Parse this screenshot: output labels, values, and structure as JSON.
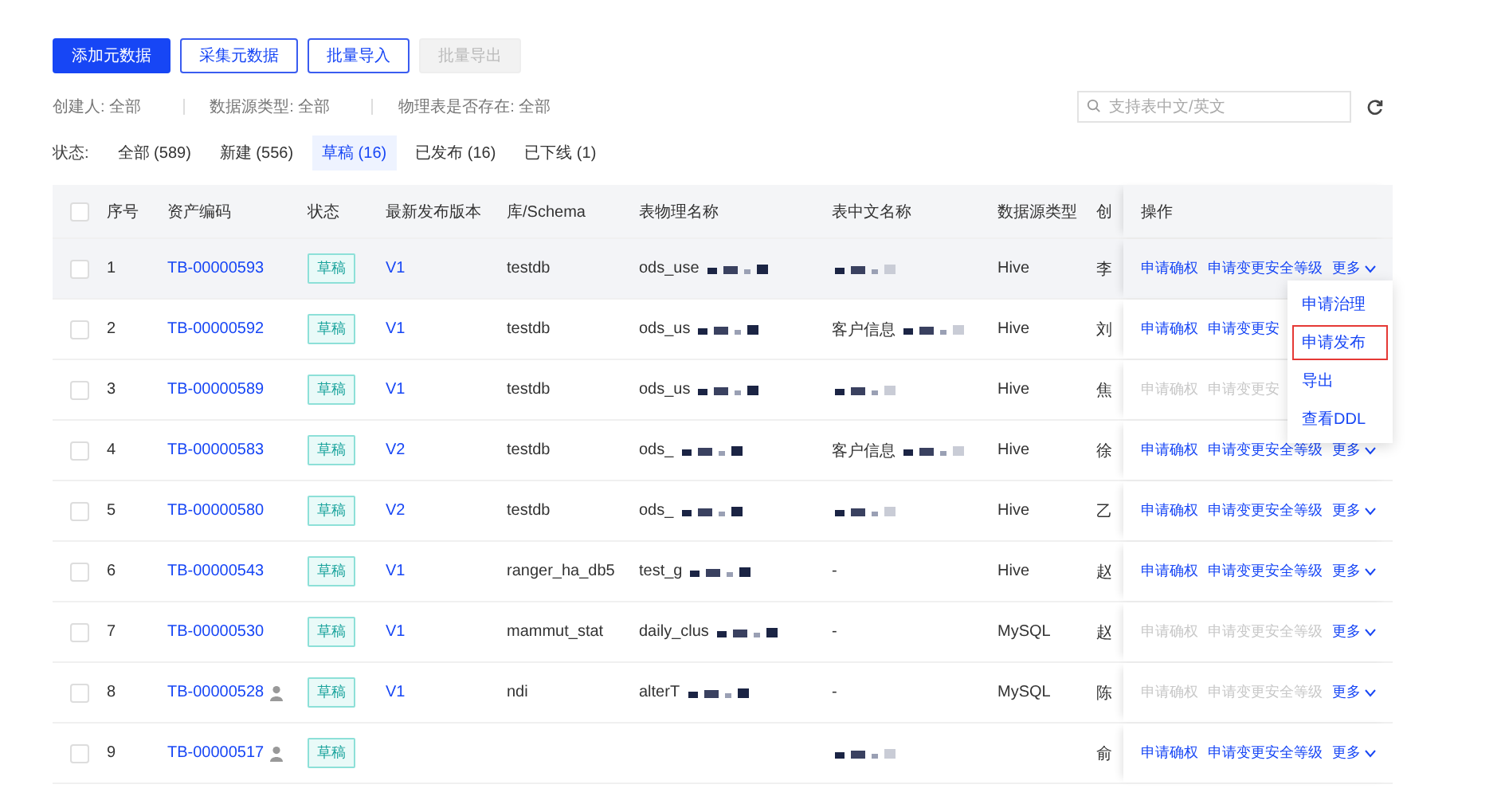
{
  "toolbar": {
    "buttons": [
      {
        "label": "添加元数据",
        "kind": "primary",
        "disabled": false
      },
      {
        "label": "采集元数据",
        "kind": "outline",
        "disabled": false
      },
      {
        "label": "批量导入",
        "kind": "outline",
        "disabled": false
      },
      {
        "label": "批量导出",
        "kind": "outline",
        "disabled": true
      }
    ]
  },
  "filters": [
    {
      "label": "创建人:",
      "value": "全部"
    },
    {
      "label": "数据源类型:",
      "value": "全部"
    },
    {
      "label": "物理表是否存在:",
      "value": "全部"
    }
  ],
  "search": {
    "placeholder": "支持表中文/英文"
  },
  "status_tabs": {
    "label": "状态:",
    "tabs": [
      {
        "label": "全部 (589)",
        "selected": false
      },
      {
        "label": "新建 (556)",
        "selected": false
      },
      {
        "label": "草稿 (16)",
        "selected": true
      },
      {
        "label": "已发布 (16)",
        "selected": false
      },
      {
        "label": "已下线 (1)",
        "selected": false
      }
    ]
  },
  "table": {
    "select_all": {
      "checked": false
    },
    "columns": [
      "序号",
      "资产编码",
      "状态",
      "最新发布版本",
      "库/Schema",
      "表物理名称",
      "表中文名称",
      "数据源类型",
      "创",
      "操作"
    ],
    "rows": [
      {
        "index": "1",
        "code": "TB-00000593",
        "owner_icon": false,
        "status": "草稿",
        "version": "V1",
        "schema": "testdb",
        "physical": "ods_use",
        "physical_redacted": true,
        "chinese": "",
        "chinese_redacted": true,
        "source": "Hive",
        "creator": "李",
        "hovered": true,
        "actions": [
          {
            "label": "申请确权",
            "disabled": false
          },
          {
            "label": "申请变更安全等级",
            "disabled": false
          }
        ],
        "more": "更多"
      },
      {
        "index": "2",
        "code": "TB-00000592",
        "owner_icon": false,
        "status": "草稿",
        "version": "V1",
        "schema": "testdb",
        "physical": "ods_us",
        "physical_redacted": true,
        "chinese": "客户信息",
        "chinese_redacted": true,
        "source": "Hive",
        "creator": "刘",
        "hovered": false,
        "actions": [
          {
            "label": "申请确权",
            "disabled": false
          },
          {
            "label": "申请变更安",
            "disabled": false
          }
        ]
      },
      {
        "index": "3",
        "code": "TB-00000589",
        "owner_icon": false,
        "status": "草稿",
        "version": "V1",
        "schema": "testdb",
        "physical": "ods_us",
        "physical_redacted": true,
        "chinese": "",
        "chinese_redacted": true,
        "source": "Hive",
        "creator": "焦",
        "hovered": false,
        "actions": [
          {
            "label": "申请确权",
            "disabled": true
          },
          {
            "label": "申请变更安",
            "disabled": true
          }
        ]
      },
      {
        "index": "4",
        "code": "TB-00000583",
        "owner_icon": false,
        "status": "草稿",
        "version": "V2",
        "schema": "testdb",
        "physical": "ods_",
        "physical_redacted": true,
        "chinese": "客户信息",
        "chinese_redacted": true,
        "source": "Hive",
        "creator": "徐",
        "hovered": false,
        "actions": [
          {
            "label": "申请确权",
            "disabled": false
          },
          {
            "label": "申请变更安全等级",
            "disabled": false
          }
        ],
        "more": "更多"
      },
      {
        "index": "5",
        "code": "TB-00000580",
        "owner_icon": false,
        "status": "草稿",
        "version": "V2",
        "schema": "testdb",
        "physical": "ods_",
        "physical_redacted": true,
        "chinese": "",
        "chinese_redacted": true,
        "source": "Hive",
        "creator": "乙",
        "hovered": false,
        "actions": [
          {
            "label": "申请确权",
            "disabled": false
          },
          {
            "label": "申请变更安全等级",
            "disabled": false
          }
        ],
        "more": "更多"
      },
      {
        "index": "6",
        "code": "TB-00000543",
        "owner_icon": false,
        "status": "草稿",
        "version": "V1",
        "schema": "ranger_ha_db5",
        "physical": "test_g",
        "physical_redacted": true,
        "chinese": "-",
        "chinese_redacted": false,
        "source": "Hive",
        "creator": "赵",
        "hovered": false,
        "actions": [
          {
            "label": "申请确权",
            "disabled": false
          },
          {
            "label": "申请变更安全等级",
            "disabled": false
          }
        ],
        "more": "更多"
      },
      {
        "index": "7",
        "code": "TB-00000530",
        "owner_icon": false,
        "status": "草稿",
        "version": "V1",
        "schema": "mammut_stat",
        "physical": "daily_clus",
        "physical_redacted": true,
        "chinese": "-",
        "chinese_redacted": false,
        "source": "MySQL",
        "creator": "赵",
        "hovered": false,
        "actions": [
          {
            "label": "申请确权",
            "disabled": true
          },
          {
            "label": "申请变更安全等级",
            "disabled": true
          }
        ],
        "more": "更多"
      },
      {
        "index": "8",
        "code": "TB-00000528",
        "owner_icon": true,
        "status": "草稿",
        "version": "V1",
        "schema": "ndi",
        "physical": "alterT",
        "physical_redacted": true,
        "chinese": "-",
        "chinese_redacted": false,
        "source": "MySQL",
        "creator": "陈",
        "hovered": false,
        "actions": [
          {
            "label": "申请确权",
            "disabled": true
          },
          {
            "label": "申请变更安全等级",
            "disabled": true
          }
        ],
        "more": "更多"
      },
      {
        "index": "9",
        "code": "TB-00000517",
        "owner_icon": true,
        "status": "草稿",
        "version": "",
        "schema": "",
        "physical": "",
        "physical_redacted": false,
        "chinese": "",
        "chinese_redacted": true,
        "source": "",
        "creator": "俞",
        "hovered": false,
        "actions": [
          {
            "label": "申请确权",
            "disabled": false
          },
          {
            "label": "申请变更安全等级",
            "disabled": false
          }
        ],
        "more": "更多"
      }
    ]
  },
  "more_menu": {
    "items": [
      {
        "label": "申请治理",
        "highlighted": false
      },
      {
        "label": "申请发布",
        "highlighted": true
      },
      {
        "label": "导出",
        "highlighted": false
      },
      {
        "label": "查看DDL",
        "highlighted": false
      }
    ]
  }
}
